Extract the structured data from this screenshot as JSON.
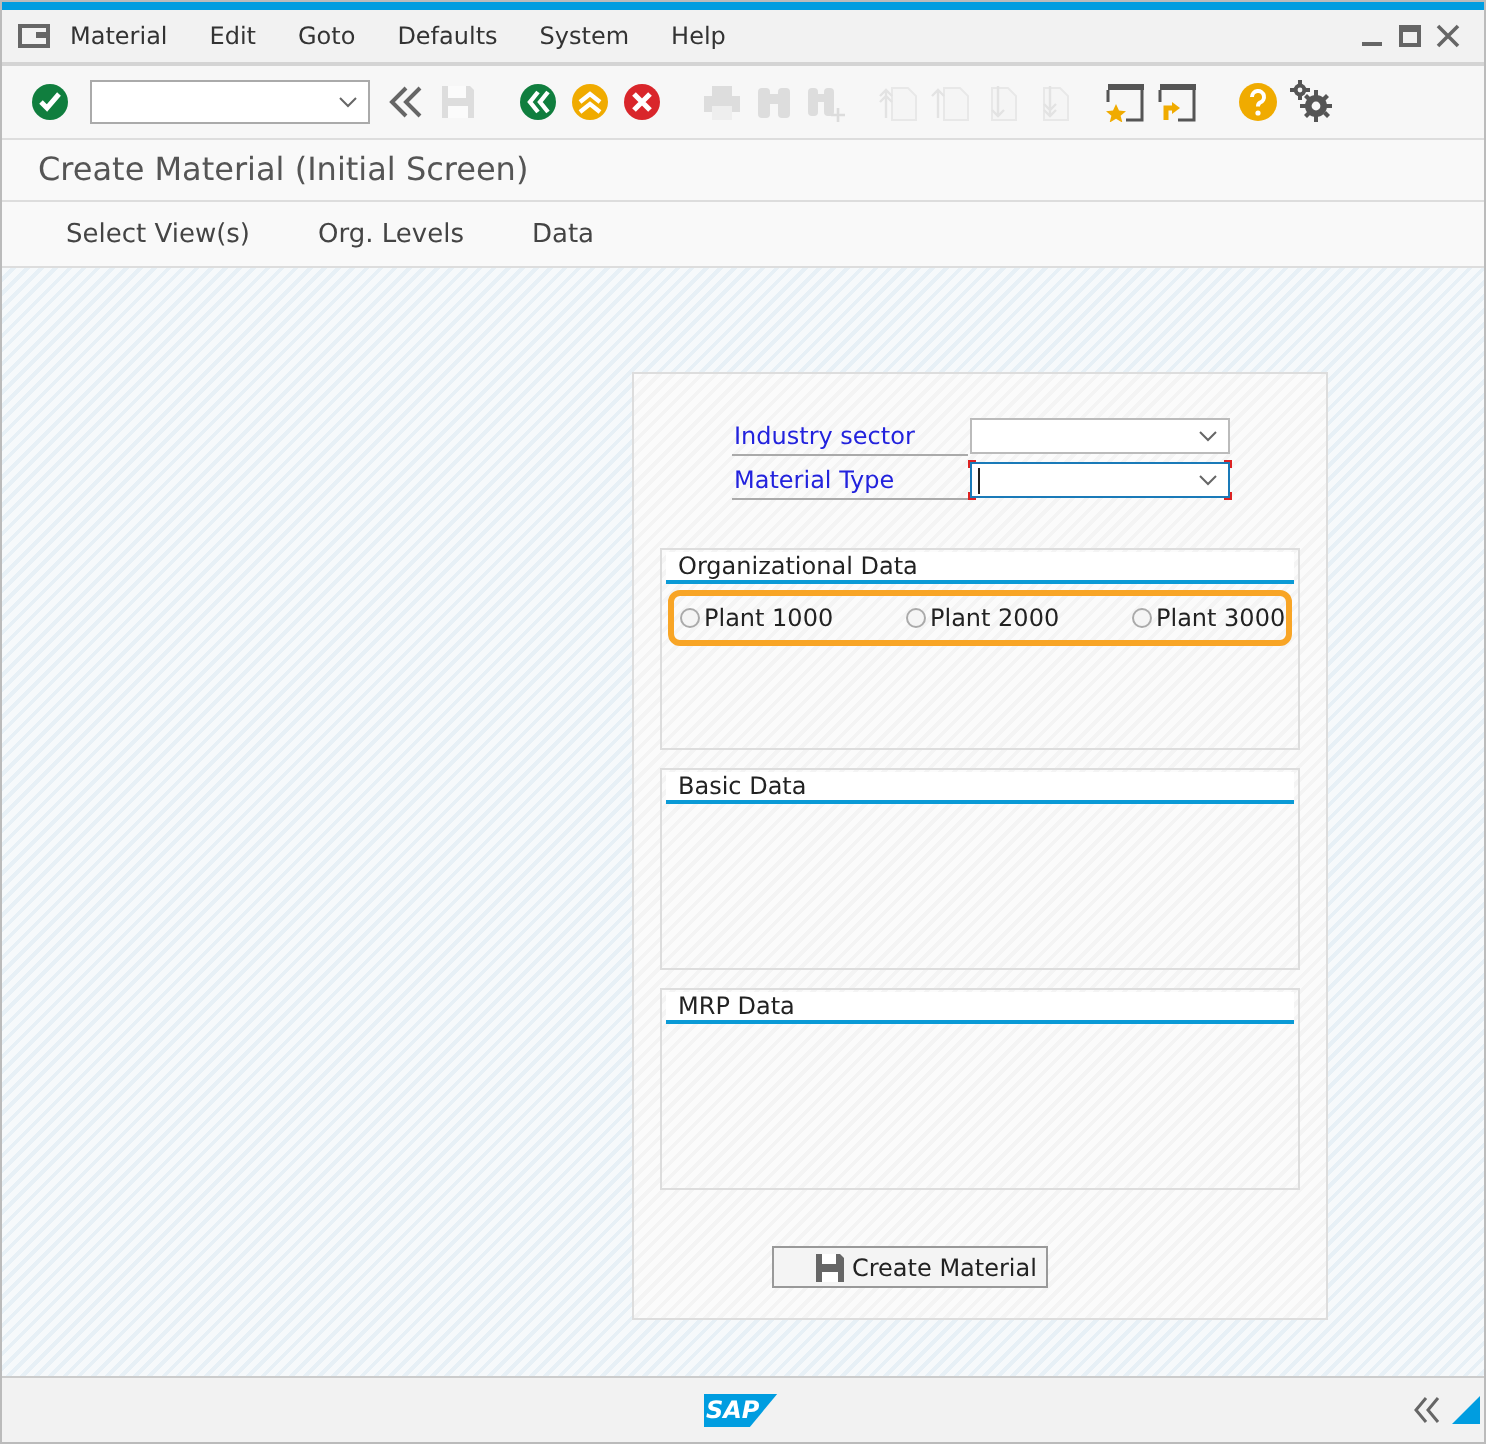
{
  "menu_bar": {
    "items": [
      {
        "label": "Material"
      },
      {
        "label": "Edit"
      },
      {
        "label": "Goto"
      },
      {
        "label": "Defaults"
      },
      {
        "label": "System"
      },
      {
        "label": "Help"
      }
    ]
  },
  "toolbar": {
    "buttons": [
      {
        "kind": "enter",
        "disabled": false
      },
      {
        "kind": "command"
      },
      {
        "kind": "chevrons",
        "disabled": false
      },
      {
        "kind": "save",
        "disabled": true
      },
      {
        "kind": "back",
        "disabled": false
      },
      {
        "kind": "exit",
        "disabled": false
      },
      {
        "kind": "cancel",
        "disabled": false
      },
      {
        "kind": "print",
        "disabled": true
      },
      {
        "kind": "find",
        "disabled": true
      },
      {
        "kind": "findnext",
        "disabled": true
      },
      {
        "kind": "first",
        "disabled": true
      },
      {
        "kind": "prev",
        "disabled": true
      },
      {
        "kind": "next",
        "disabled": true
      },
      {
        "kind": "last",
        "disabled": true
      },
      {
        "kind": "session",
        "disabled": false
      },
      {
        "kind": "shortcut",
        "disabled": false
      },
      {
        "kind": "help",
        "disabled": false
      },
      {
        "kind": "settings",
        "disabled": false
      }
    ]
  },
  "title": "Create Material (Initial Screen)",
  "app_toolbar": [
    {
      "label": "Select View(s)"
    },
    {
      "label": "Org. Levels"
    },
    {
      "label": "Data"
    }
  ],
  "form": {
    "fields": [
      {
        "label": "Industry sector",
        "focused": false,
        "required": false
      },
      {
        "label": "Material Type",
        "focused": true,
        "required": true
      }
    ],
    "groups": [
      {
        "title": "Organizational Data",
        "highlighted": true,
        "radios": [
          {
            "label": "Plant 1000",
            "selected": false
          },
          {
            "label": "Plant 2000",
            "selected": false
          },
          {
            "label": "Plant 3000",
            "selected": false
          }
        ]
      },
      {
        "title": "Basic Data",
        "highlighted": false
      },
      {
        "title": "MRP Data",
        "highlighted": false
      }
    ],
    "button": {
      "label": "Create Material"
    }
  },
  "status_bar": {
    "logo": "SAP"
  }
}
